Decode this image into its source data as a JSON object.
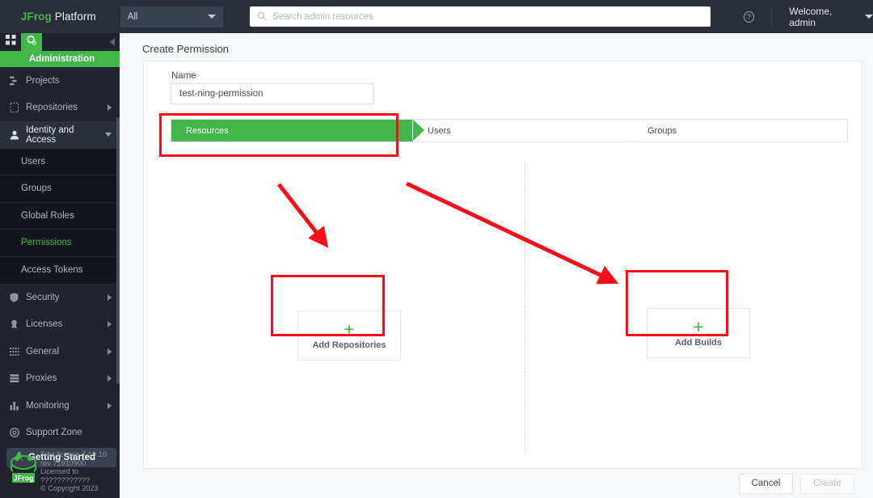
{
  "topbar": {
    "brand_jfrog": "JFrog",
    "brand_platform": "Platform",
    "scope_value": "All",
    "search_placeholder": "Search admin resources",
    "search_value": "",
    "help_glyph": "?",
    "welcome": "Welcome, admin"
  },
  "sidebar": {
    "admin_banner": "Administration",
    "nav": [
      {
        "label": "Projects",
        "icon": "projects-icon",
        "expandable": false
      },
      {
        "label": "Repositories",
        "icon": "repositories-icon",
        "expandable": true
      },
      {
        "label": "Identity and Access",
        "icon": "user-icon",
        "expandable": true,
        "open": true
      },
      {
        "label": "Security",
        "icon": "shield-icon",
        "expandable": true
      },
      {
        "label": "Licenses",
        "icon": "medal-icon",
        "expandable": true
      },
      {
        "label": "General",
        "icon": "grid-dots-icon",
        "expandable": true
      },
      {
        "label": "Proxies",
        "icon": "server-icon",
        "expandable": true
      },
      {
        "label": "Monitoring",
        "icon": "bar-chart-icon",
        "expandable": true
      },
      {
        "label": "Support Zone",
        "icon": "lifebuoy-icon",
        "expandable": false
      }
    ],
    "subnav": [
      {
        "label": "Users",
        "active": false
      },
      {
        "label": "Groups",
        "active": false
      },
      {
        "label": "Global Roles",
        "active": false
      },
      {
        "label": "Permissions",
        "active": true
      },
      {
        "label": "Access Tokens",
        "active": false
      }
    ],
    "getting_started": "Getting Started",
    "license": {
      "line1": "Trial license 7.19.10",
      "line2": "rev 71910900",
      "line3": "Licensed to",
      "line4": "????????????",
      "line5": "© Copyright 2023"
    }
  },
  "main": {
    "page_title": "Create Permission",
    "name_label": "Name",
    "name_value": "test-ning-permission",
    "name_placeholder": "",
    "steps": [
      {
        "label": "Resources",
        "active": true
      },
      {
        "label": "Users",
        "active": false
      },
      {
        "label": "Groups",
        "active": false
      }
    ],
    "add_repositories": {
      "caption": "Add Repositories",
      "plus": "+"
    },
    "add_builds": {
      "caption": "Add Builds",
      "plus": "+"
    },
    "footer": {
      "cancel": "Cancel",
      "create": "Create"
    }
  },
  "colors": {
    "green": "#43b649",
    "topbar_bg": "#2b2f3a",
    "sidebar_bg": "#21242e",
    "subnav_bg": "#14161d",
    "annotation_red": "#fc0d1b"
  }
}
